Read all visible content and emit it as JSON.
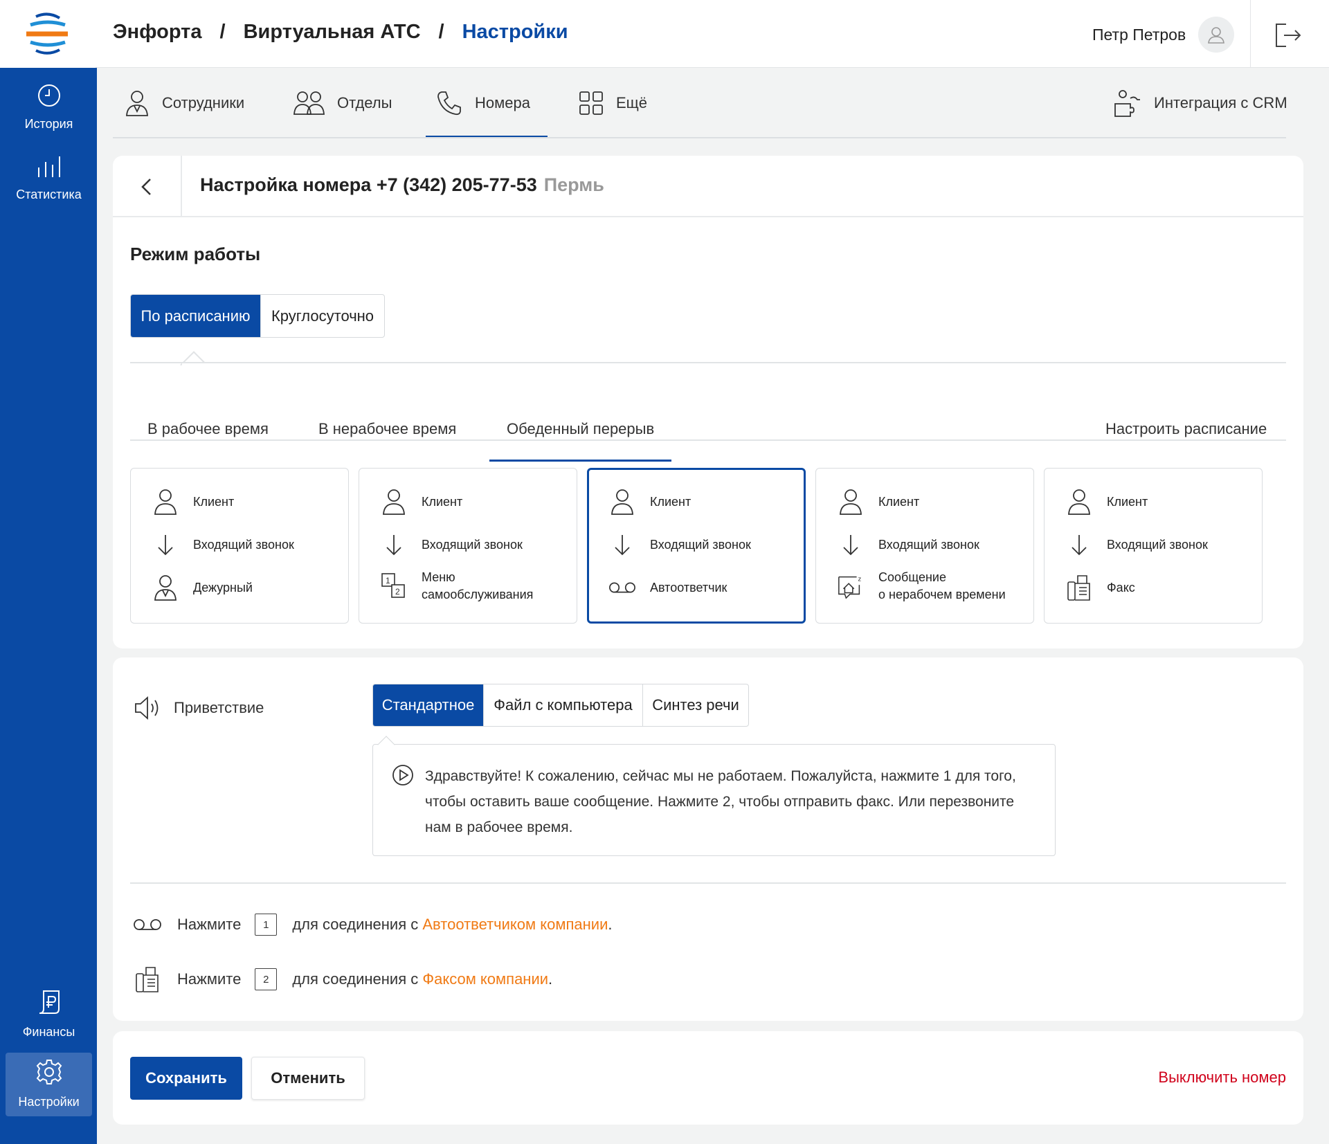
{
  "breadcrumb": [
    "Энфорта",
    "/",
    "Виртуальная АТС",
    "/",
    "Настройки"
  ],
  "user": {
    "name": "Петр Петров"
  },
  "sidebar": {
    "items": [
      {
        "label": "История",
        "icon": "clock-icon"
      },
      {
        "label": "Статистика",
        "icon": "bar-stats-icon"
      },
      {
        "label": "Финансы",
        "icon": "ruble-doc-icon"
      },
      {
        "label": "Настройки",
        "icon": "gear-icon"
      }
    ]
  },
  "nav": {
    "tabs": [
      {
        "label": "Сотрудники",
        "icon": "employee-icon"
      },
      {
        "label": "Отделы",
        "icon": "departments-icon"
      },
      {
        "label": "Номера",
        "icon": "phone-icon"
      },
      {
        "label": "Ещё",
        "icon": "grid-icon"
      }
    ],
    "crm": "Интеграция с CRM"
  },
  "card": {
    "title": "Настройка номера +7 (342) 205-77-53",
    "city": "Пермь",
    "mode_title": "Режим работы",
    "mode_options": [
      "По расписанию",
      "Круглосуточно"
    ],
    "subtabs": [
      "В рабочее время",
      "В нерабочее время",
      "Обеденный перерыв"
    ],
    "schedule_link": "Настроить расписание",
    "flows": [
      {
        "r1": "Клиент",
        "r2": "Входящий звонок",
        "r3": "Дежурный"
      },
      {
        "r1": "Клиент",
        "r2": "Входящий звонок",
        "r3a": "Меню",
        "r3b": "самообслуживания"
      },
      {
        "r1": "Клиент",
        "r2": "Входящий звонок",
        "r3": "Автоответчик"
      },
      {
        "r1": "Клиент",
        "r2": "Входящий звонок",
        "r3a": "Сообщение",
        "r3b": "о нерабочем времени"
      },
      {
        "r1": "Клиент",
        "r2": "Входящий звонок",
        "r3": "Факс"
      }
    ]
  },
  "greeting": {
    "label": "Приветствие",
    "options": [
      "Стандартное",
      "Файл с компьютера",
      "Синтез речи"
    ],
    "text": "Здравствуйте! К сожалению, сейчас мы не работаем. Пожалуйста, нажмите 1 для того, чтобы оставить ваше сообщение. Нажмите 2, чтобы отправить факс. Или перезвоните нам в рабочее время."
  },
  "press": [
    {
      "prefix": "Нажмите",
      "key": "1",
      "text": "для соединения с",
      "link": "Автоответчиком компании",
      "suffix": "."
    },
    {
      "prefix": "Нажмите",
      "key": "2",
      "text": "для соединения с",
      "link": "Факсом компании",
      "suffix": "."
    }
  ],
  "actions": {
    "save": "Сохранить",
    "cancel": "Отменить",
    "disable": "Выключить номер"
  },
  "colors": {
    "brand": "#0a4aa4",
    "accent_link": "#f07a14",
    "danger": "#d0021b"
  }
}
